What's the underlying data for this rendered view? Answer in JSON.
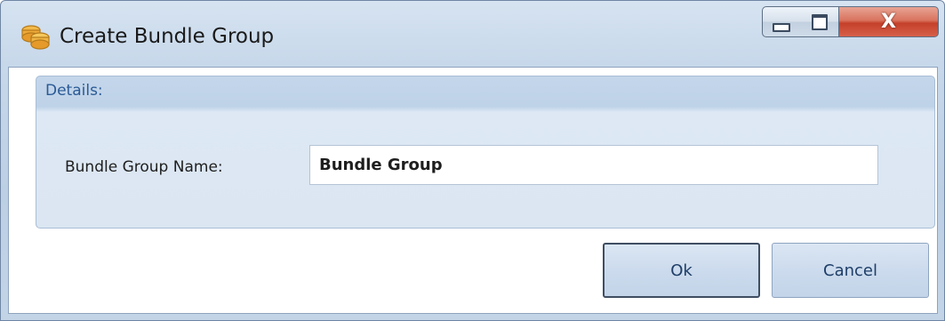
{
  "window": {
    "title": "Create Bundle Group",
    "icon": "bundle-group-icon",
    "controls": {
      "minimize": "minimize-icon",
      "maximize": "maximize-icon",
      "close_glyph": "X"
    }
  },
  "details": {
    "title": "Details:",
    "bundle_group_name_label": "Bundle Group Name:",
    "bundle_group_name_value": "Bundle Group"
  },
  "buttons": {
    "ok": "Ok",
    "cancel": "Cancel"
  },
  "colors": {
    "group_title": "#2a5a96",
    "button_text": "#1e3e68",
    "close_button": "#c4402a"
  }
}
